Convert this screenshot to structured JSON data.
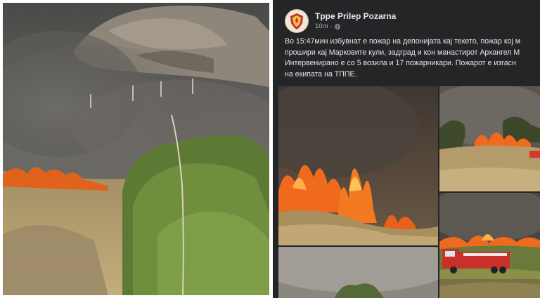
{
  "post": {
    "page_name": "Tppe Prilep Pozarna",
    "time": "10m",
    "separator": "·",
    "visibility_icon": "globe-icon",
    "text_lines": [
      "Во 15:47мин избувнат е пожар на депонијата кај текето, пожар кој м",
      "прошири кај Марковите кули, задград и кон манастирот Архангел М",
      "Интервенирано е со 5 возила и 17 пожарникари. Пожарот е изгасн",
      "на екипата на ТППЕ."
    ]
  },
  "colors": {
    "post_background": "#242526",
    "text_primary": "#e4e6eb",
    "text_secondary": "#b0b3b8",
    "fire": "#f06a1e",
    "fire_truck": "#c8302a"
  },
  "photos": {
    "left": "photo-grassfire-hillside",
    "grid": [
      "photo-flames-closeup",
      "photo-fire-line-hill",
      "photo-fire-truck",
      "photo-smoke-trees",
      "photo-partial"
    ]
  }
}
